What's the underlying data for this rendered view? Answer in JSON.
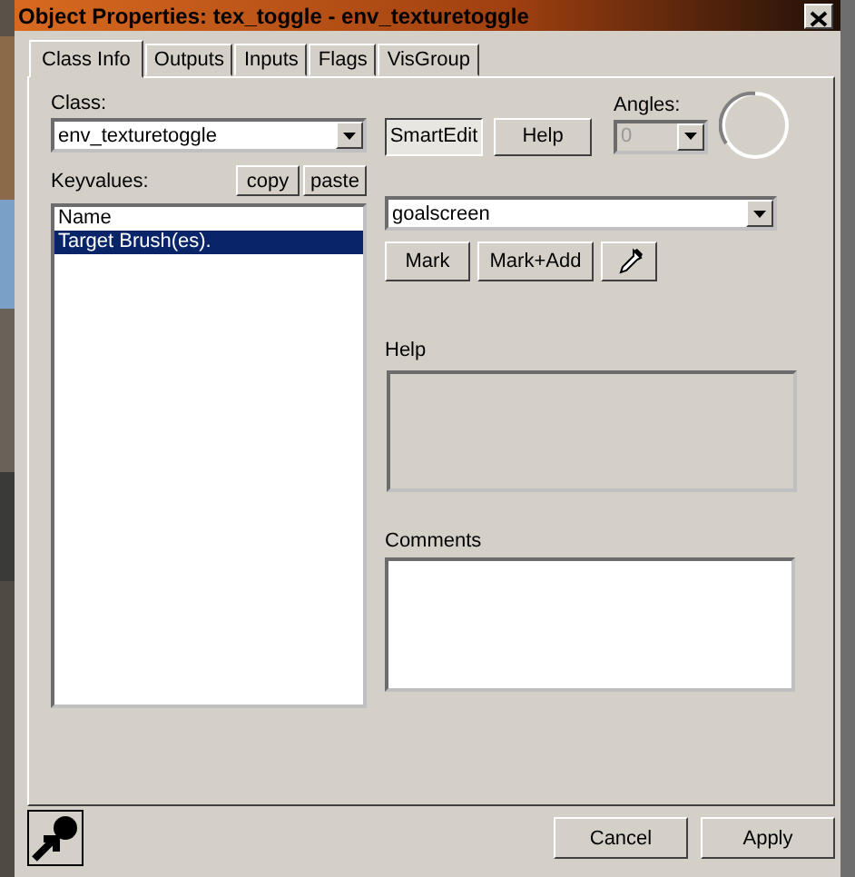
{
  "window": {
    "title": "Object Properties: tex_toggle - env_texturetoggle"
  },
  "tabs": [
    {
      "label": "Class Info",
      "selected": true
    },
    {
      "label": "Outputs",
      "selected": false
    },
    {
      "label": "Inputs",
      "selected": false
    },
    {
      "label": "Flags",
      "selected": false
    },
    {
      "label": "VisGroup",
      "selected": false
    }
  ],
  "class_field": {
    "label": "Class:",
    "value": "env_texturetoggle"
  },
  "smartedit_button": {
    "label": "SmartEdit",
    "on": true
  },
  "help_button": "Help",
  "angles": {
    "label": "Angles:",
    "value": "0",
    "disabled": true
  },
  "keyvalues": {
    "label": "Keyvalues:",
    "buttons": [
      "copy",
      "paste"
    ],
    "items": [
      {
        "label": "Name",
        "selected": false
      },
      {
        "label": "Target Brush(es).",
        "selected": true
      }
    ]
  },
  "value_field": {
    "value": "goalscreen"
  },
  "mark_buttons": [
    "Mark",
    "Mark+Add"
  ],
  "help_section": {
    "label": "Help"
  },
  "comments": {
    "label": "Comments"
  },
  "footer_buttons": [
    "Cancel",
    "Apply"
  ]
}
